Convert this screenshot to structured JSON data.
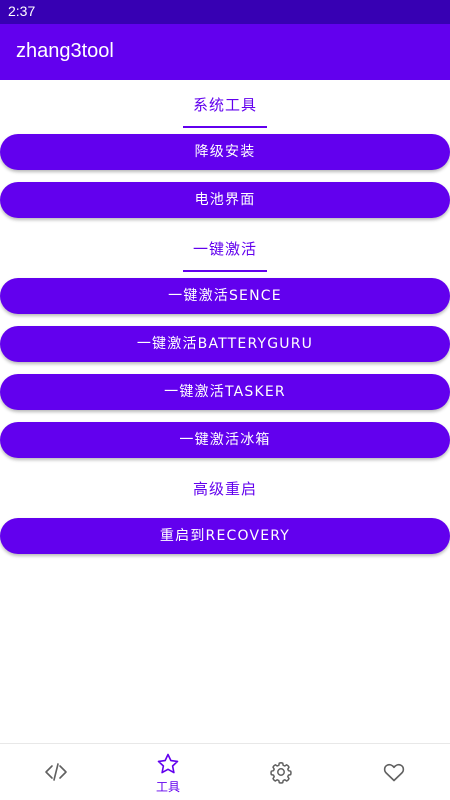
{
  "status_bar": {
    "time": "2:37"
  },
  "app_bar": {
    "title": "zhang3tool"
  },
  "sections": {
    "system_tools": "系统工具",
    "one_click_activation": "一键激活",
    "advanced_reboot": "高级重启"
  },
  "buttons": {
    "downgrade_install": "降级安装",
    "battery_screen": "电池界面",
    "activate_scene": "一键激活SENCE",
    "activate_batteryguru": "一键激活BATTERYGURU",
    "activate_tasker": "一键激活TASKER",
    "activate_icebox": "一键激活冰箱",
    "reboot_recovery": "重启到RECOVERY"
  },
  "bottom_nav": {
    "items": [
      {
        "icon": "code-icon",
        "label": ""
      },
      {
        "icon": "star-icon",
        "label": "工具",
        "selected": true
      },
      {
        "icon": "gear-icon",
        "label": ""
      },
      {
        "icon": "heart-icon",
        "label": ""
      }
    ]
  },
  "colors": {
    "status_bar": "#3700b3",
    "primary": "#6200ee",
    "nav_inactive": "#606060"
  }
}
